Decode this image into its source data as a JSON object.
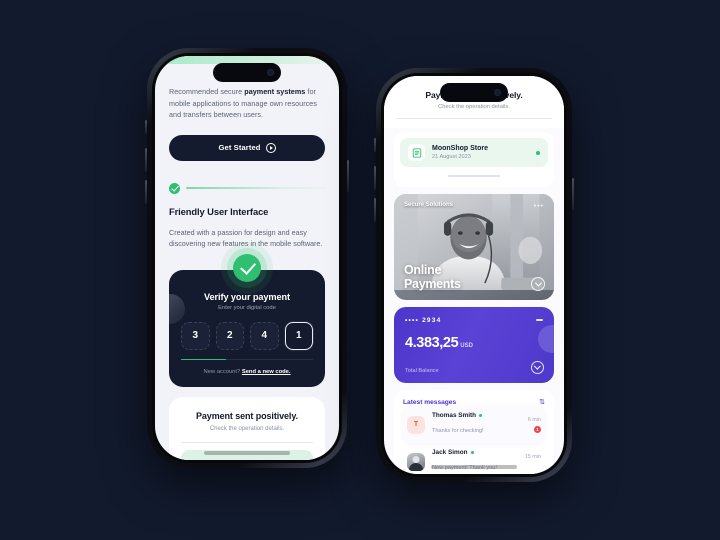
{
  "background_color": "#121a2e",
  "left_phone": {
    "intro": {
      "text_before": "Recommended secure ",
      "text_bold": "payment systems",
      "text_after": " for mobile applications to manage own resources and transfers between users."
    },
    "cta": {
      "label": "Get Started",
      "icon": "arrow-right-circle-icon"
    },
    "step": {
      "status_icon": "check-circle-icon",
      "heading": "Friendly User Interface",
      "body": "Created with a passion for design and easy discovering new features in the mobile software."
    },
    "verify": {
      "success_icon": "check-circle-icon",
      "title": "Verify your payment",
      "hint": "Enter your digital code",
      "code": [
        "3",
        "2",
        "4",
        "1"
      ],
      "active_index": 3,
      "progress_percent": 34,
      "footer_text": "New account?",
      "footer_link": "Send a new code."
    },
    "sent": {
      "title": "Payment sent positively.",
      "subtitle": "Check the operation details."
    }
  },
  "right_phone": {
    "header": {
      "title": "Payment sent positively.",
      "subtitle": "Check the operation details."
    },
    "store": {
      "icon": "receipt-icon",
      "name": "MoonShop Store",
      "date": "21 August 2023",
      "status_dot": "#2fbf71"
    },
    "promo": {
      "tag": "Secure Solutions",
      "menu_icon": "more-horizontal-icon",
      "title_line1": "Online",
      "title_line2": "Payments",
      "action_icon": "arrow-down-right-circle-icon"
    },
    "balance": {
      "card_mask": "•••• 2934",
      "amount": "4.383,25",
      "currency": "USD",
      "label": "Total Balance",
      "action_icon": "arrow-down-right-circle-icon",
      "accent": "#4c35c9"
    },
    "messages": {
      "title": "Latest messages",
      "sort_icon": "sort-icon",
      "items": [
        {
          "avatar_kind": "letter",
          "avatar_text": "T",
          "name": "Thomas Smith",
          "preview": "Thanks for checking!",
          "time": "6 min",
          "badge": "1",
          "online": true
        },
        {
          "avatar_kind": "photo",
          "avatar_text": "",
          "name": "Jack Simon",
          "preview": "New payment! Thank you!",
          "time": "15 min",
          "badge": "",
          "online": true
        }
      ]
    }
  }
}
